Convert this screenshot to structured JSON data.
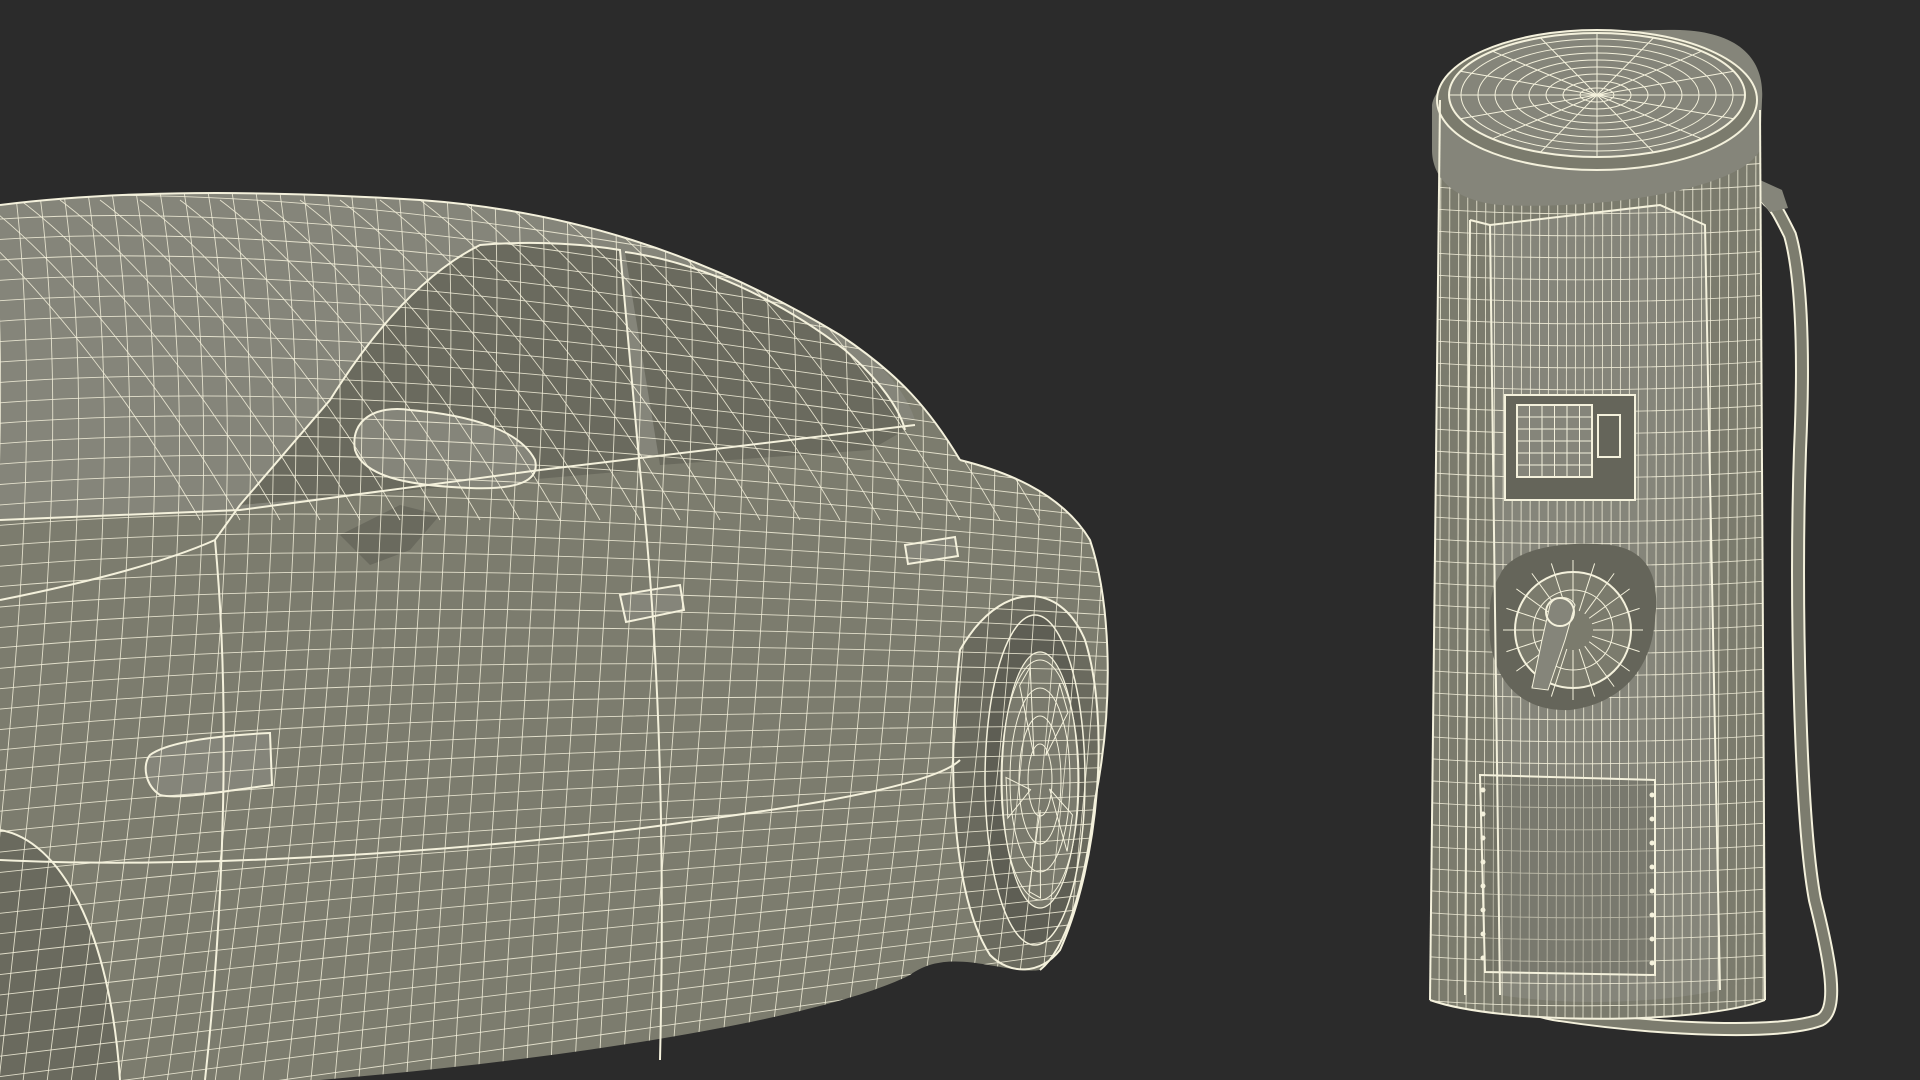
{
  "scene": {
    "background_color": "#2b2b2b",
    "model_fill": "#7f7f70",
    "model_fill_light": "#8a8a7c",
    "model_fill_dark": "#6b6b5e",
    "wire_color": "#f4f1dc",
    "objects": [
      "car",
      "ev-charging-station"
    ]
  }
}
